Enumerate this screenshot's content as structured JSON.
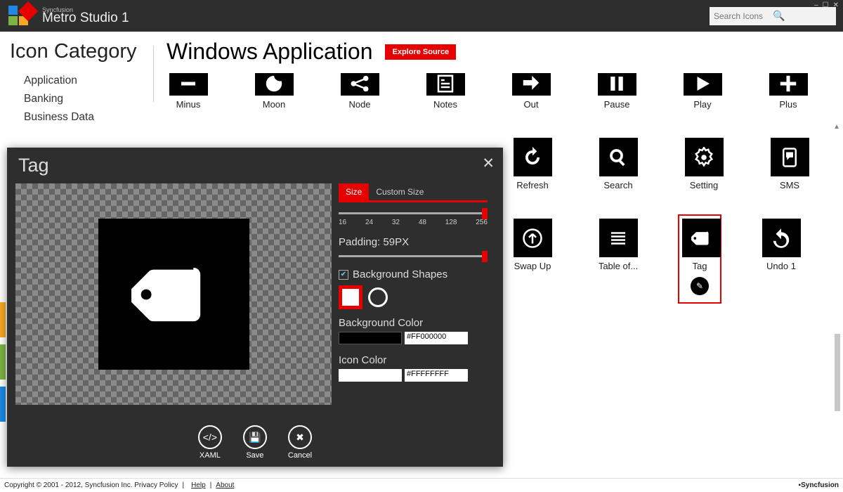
{
  "header": {
    "brand_small": "Syncfusion",
    "brand_main": "Metro Studio 1",
    "search_placeholder": "Search Icons"
  },
  "window_controls": [
    "–",
    "☐",
    "✕"
  ],
  "sidebar": {
    "title": "Icon Category",
    "items": [
      "Application",
      "Banking",
      "Business Data"
    ]
  },
  "main": {
    "title": "Windows Application",
    "explore_btn": "Explore Source",
    "row1": [
      {
        "label": "Minus",
        "icon": "minus"
      },
      {
        "label": "Moon",
        "icon": "moon"
      },
      {
        "label": "Node",
        "icon": "node"
      },
      {
        "label": "Notes",
        "icon": "notes"
      },
      {
        "label": "Out",
        "icon": "out"
      },
      {
        "label": "Pause",
        "icon": "pause"
      },
      {
        "label": "Play",
        "icon": "play"
      },
      {
        "label": "Plus",
        "icon": "plus"
      }
    ],
    "row2": [
      {
        "label": "Refresh",
        "icon": "refresh"
      },
      {
        "label": "Search",
        "icon": "search"
      },
      {
        "label": "Setting",
        "icon": "setting"
      },
      {
        "label": "SMS",
        "icon": "sms"
      }
    ],
    "row3": [
      {
        "label": "Swap Up",
        "icon": "swapup"
      },
      {
        "label": "Table of...",
        "icon": "table"
      },
      {
        "label": "Tag",
        "icon": "tag",
        "selected": true
      },
      {
        "label": "Undo 1",
        "icon": "undo"
      }
    ]
  },
  "dialog": {
    "title": "Tag",
    "tabs": [
      "Size",
      "Custom Size"
    ],
    "active_tab": 0,
    "ticks": [
      "16",
      "24",
      "32",
      "48",
      "128",
      "256"
    ],
    "padding_label": "Padding: 59PX",
    "bg_shapes_label": "Background Shapes",
    "bg_shapes_checked": true,
    "bg_color_label": "Background Color",
    "bg_color_hex": "#FF000000",
    "icon_color_label": "Icon Color",
    "icon_color_hex": "#FFFFFFFF",
    "actions": [
      {
        "label": "XAML",
        "glyph": "</>"
      },
      {
        "label": "Save",
        "glyph": "💾"
      },
      {
        "label": "Cancel",
        "glyph": "✖"
      }
    ]
  },
  "footer": {
    "copyright": "Copyright © 2001 - 2012, Syncfusion Inc. Privacy Policy",
    "links": [
      "Help",
      "About"
    ],
    "brand": "Syncfusion"
  },
  "side_marker_colors": [
    "#f9a825",
    "#7cb342",
    "#1e88e5"
  ]
}
